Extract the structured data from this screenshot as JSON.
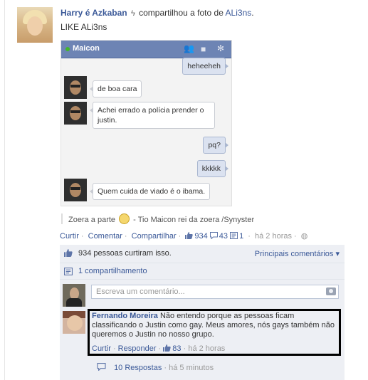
{
  "post": {
    "actor": "Harry é Azkaban",
    "action": "compartilhou a foto de",
    "target": "ALi3ns",
    "target_suffix": ".",
    "subtitle": "LIKE ALi3ns"
  },
  "photo": {
    "chat_name": "Maicon",
    "messages": [
      {
        "from": "me",
        "text": "heheeheh"
      },
      {
        "from": "them",
        "text": "de boa cara"
      },
      {
        "from": "them",
        "text": "Achei errado a polícia prender o justin."
      },
      {
        "from": "me",
        "text": "pq?"
      },
      {
        "from": "me",
        "text": "kkkkk"
      },
      {
        "from": "them",
        "text": "Quem cuida de viado é o ibama."
      }
    ]
  },
  "caption": {
    "prefix": "Zoera a parte",
    "suffix": "- Tio Maicon rei da zoera /Synyster"
  },
  "actions": {
    "like": "Curtir",
    "comment": "Comentar",
    "share": "Compartilhar",
    "likes_count": "934",
    "comments_count": "43",
    "shares_count": "1",
    "time": "há 2 horas"
  },
  "feedback": {
    "likes_text": "934 pessoas curtiram isso.",
    "top_comments": "Principais comentários ▾",
    "shares_text": "1 compartilhamento",
    "write_placeholder": "Escreva um comentário..."
  },
  "comment": {
    "author": "Fernando Moreira",
    "text": "Não entendo porque as pessoas ficam classificando o Justin como gay. Meus amores, nós gays também não queremos o Justin no nosso grupo.",
    "like": "Curtir",
    "reply": "Responder",
    "likes": "83",
    "time": "há 2 horas"
  },
  "replies": {
    "label": "10 Respostas",
    "time": "há 5 minutos"
  },
  "colors": {
    "link": "#3b5998",
    "chat_header": "#6d84b4",
    "feedback_bg": "#edeff4",
    "highlight": "#000000"
  },
  "icons": [
    "bolt-icon",
    "online-dot-icon",
    "add-friend-icon",
    "video-icon",
    "gear-icon",
    "emoji-icon",
    "like-icon",
    "comment-icon",
    "share-icon",
    "globe-icon",
    "camera-icon"
  ]
}
